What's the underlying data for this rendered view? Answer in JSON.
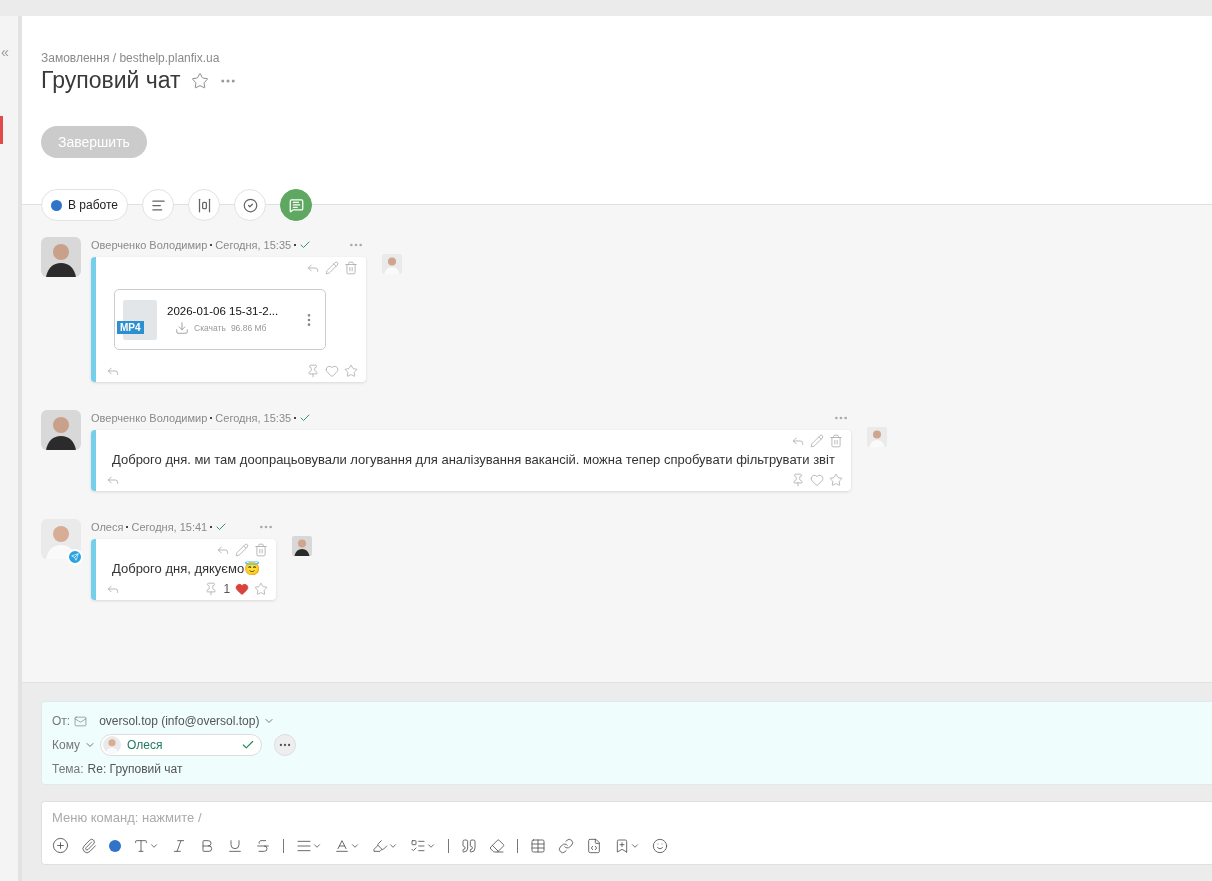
{
  "sidebar": {
    "collapse": "«",
    "alert": true
  },
  "header": {
    "breadcrumb": "Замовлення / besthelp.planfix.ua",
    "title": "Груповий чат",
    "finish_button": "Завершить"
  },
  "toolbar": {
    "status": {
      "label": "В работе",
      "color": "#2f74c8"
    },
    "tabs": [
      {
        "kind": "description",
        "selected": false
      },
      {
        "kind": "fields",
        "selected": false
      },
      {
        "kind": "checklist",
        "selected": false
      },
      {
        "kind": "chat",
        "selected": true
      }
    ]
  },
  "messages": [
    {
      "author": "Оверченко Володимир",
      "time": "Сегодня, 15:35",
      "kind": "file",
      "file": {
        "ext": "MP4",
        "name": "2026-01-06 15-31-2...",
        "action": "Скачать",
        "size": "96.86 Мб"
      },
      "liked": false,
      "telegram": false
    },
    {
      "author": "Оверченко Володимир",
      "time": "Сегодня, 15:35",
      "kind": "text",
      "text": "Доброго дня. ми там доопрацьовували логування для аналізування вакансій. можна тепер спробувати фільтрувати звіт",
      "liked": false,
      "telegram": false
    },
    {
      "author": "Олеся",
      "time": "Сегодня, 15:41",
      "kind": "text",
      "text": "Доброго дня, дякуємо😇",
      "liked": true,
      "likes": "1",
      "telegram": true
    }
  ],
  "compose": {
    "from_label": "От:",
    "from_value": "oversol.top (info@oversol.top)",
    "to_label": "Кому",
    "recipient": "Олеся",
    "subject_label": "Тема:",
    "subject": "Re: Груповий чат",
    "placeholder": "Меню команд: нажмите /"
  }
}
